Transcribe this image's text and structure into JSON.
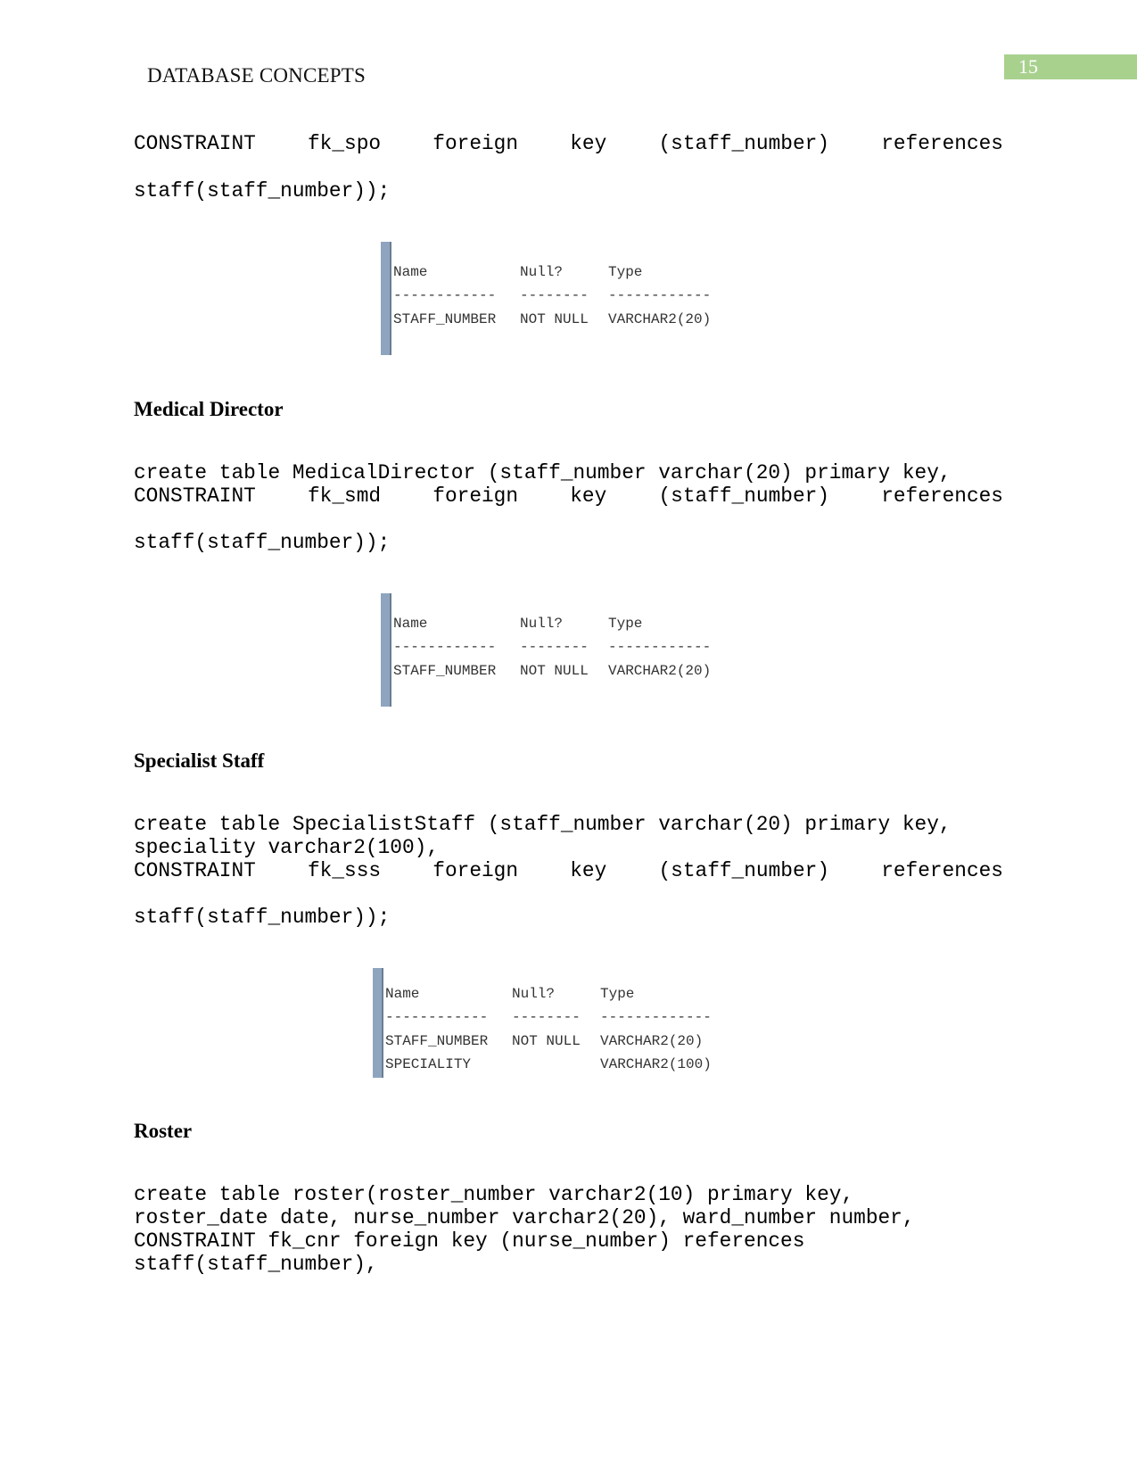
{
  "header": {
    "title": "DATABASE CONCEPTS",
    "page_number": "15",
    "page_box_color": "#a9d18e"
  },
  "section0": {
    "constraint_words": [
      "CONSTRAINT",
      "fk_spo",
      "foreign",
      "key",
      "(staff_number)",
      "references"
    ],
    "line2": "staff(staff_number));"
  },
  "table1": {
    "headers": [
      "Name",
      "Null?",
      "Type"
    ],
    "dashes": [
      "------------",
      "--------",
      "------------"
    ],
    "rows": [
      [
        "STAFF_NUMBER",
        "NOT NULL",
        "VARCHAR2(20)"
      ]
    ]
  },
  "medical_director": {
    "heading": "Medical Director",
    "line1": "create table MedicalDirector (staff_number varchar(20) primary key,",
    "constraint_words": [
      "CONSTRAINT",
      "fk_smd",
      "foreign",
      "key",
      "(staff_number)",
      "references"
    ],
    "line3": "staff(staff_number));"
  },
  "table2": {
    "headers": [
      "Name",
      "Null?",
      "Type"
    ],
    "dashes": [
      "------------",
      "--------",
      "------------"
    ],
    "rows": [
      [
        "STAFF_NUMBER",
        "NOT NULL",
        "VARCHAR2(20)"
      ]
    ]
  },
  "specialist_staff": {
    "heading": "Specialist Staff",
    "line1": "create table SpecialistStaff (staff_number varchar(20) primary key,",
    "line2": "speciality varchar2(100),",
    "constraint_words": [
      "CONSTRAINT",
      "fk_sss",
      "foreign",
      "key",
      "(staff_number)",
      "references"
    ],
    "line4": "staff(staff_number));"
  },
  "table3": {
    "headers": [
      "Name",
      "Null?",
      "Type"
    ],
    "dashes": [
      "------------",
      "--------",
      "-------------"
    ],
    "rows": [
      [
        "STAFF_NUMBER",
        "NOT NULL",
        "VARCHAR2(20)"
      ],
      [
        "SPECIALITY",
        "",
        "VARCHAR2(100)"
      ]
    ]
  },
  "roster": {
    "heading": "Roster",
    "lines": [
      "create table roster(roster_number varchar2(10) primary key,",
      "roster_date date, nurse_number varchar2(20), ward_number number,",
      "CONSTRAINT fk_cnr foreign key (nurse_number) references",
      "staff(staff_number),"
    ]
  }
}
